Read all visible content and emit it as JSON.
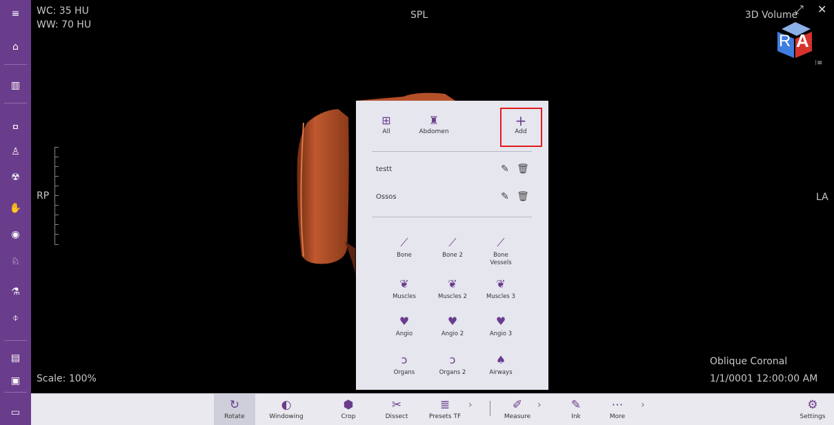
{
  "sidebar": {
    "menu": "≡",
    "items": [
      {
        "name": "hamburger-menu-icon",
        "glyph": "≡"
      },
      {
        "name": "home-icon",
        "glyph": "⌂"
      },
      {
        "name": "library-icon",
        "glyph": "▥"
      },
      {
        "name": "lungs-icon",
        "glyph": "ߛ"
      },
      {
        "name": "body-icon",
        "glyph": "♙"
      },
      {
        "name": "radiation-icon",
        "glyph": "☢"
      },
      {
        "name": "hand-bones-icon",
        "glyph": "✋"
      },
      {
        "name": "brain-icon",
        "glyph": "◉"
      },
      {
        "name": "animal-icon",
        "glyph": "♘"
      },
      {
        "name": "microscope-icon",
        "glyph": "⚗"
      },
      {
        "name": "attachment-icon",
        "glyph": "⌽"
      },
      {
        "name": "slides-icon",
        "glyph": "▤"
      },
      {
        "name": "snapshot-icon",
        "glyph": "▣"
      },
      {
        "name": "save-icon",
        "glyph": "▭"
      }
    ]
  },
  "viewport": {
    "wc": "WC: 35 HU",
    "ww": "WW: 70 HU",
    "orientation_top": "SPL",
    "mode": "3D Volume",
    "left_label": "RP",
    "right_label": "LA",
    "scale": "Scale: 100%",
    "view_name": "Oblique Coronal",
    "datetime": "1/1/0001 12:00:00 AM",
    "cube_letters": [
      "R",
      "A"
    ],
    "list_icon": "⁝≡"
  },
  "panel": {
    "top_buttons": [
      {
        "label": "All",
        "icon": "⊞"
      },
      {
        "label": "Abdomen",
        "icon": "♜"
      },
      {
        "label": "Add",
        "icon": "+"
      }
    ],
    "saved": [
      {
        "name": "testt",
        "edit": "✎",
        "delete": "🗑"
      },
      {
        "name": "Ossos",
        "edit": "✎",
        "delete": "🗑"
      }
    ],
    "presets": [
      {
        "label": "Bone",
        "icon": "⟋"
      },
      {
        "label": "Bone 2",
        "icon": "⟋"
      },
      {
        "label": "Bone\nVessels",
        "icon": "⟋"
      },
      {
        "label": "Muscles",
        "icon": "❦"
      },
      {
        "label": "Muscles 2",
        "icon": "❦"
      },
      {
        "label": "Muscles 3",
        "icon": "❦"
      },
      {
        "label": "Angio",
        "icon": "♥"
      },
      {
        "label": "Angio 2",
        "icon": "♥"
      },
      {
        "label": "Angio 3",
        "icon": "♥"
      },
      {
        "label": "Organs",
        "icon": "ɔ"
      },
      {
        "label": "Organs 2",
        "icon": "ɔ"
      },
      {
        "label": "Airways",
        "icon": "♠"
      }
    ]
  },
  "toolbar": {
    "items": [
      {
        "label": "Rotate",
        "icon": "↻"
      },
      {
        "label": "Windowing",
        "icon": "◐"
      },
      {
        "label": "Crop",
        "icon": "⬢"
      },
      {
        "label": "Dissect",
        "icon": "✂"
      },
      {
        "label": "Presets TF",
        "icon": "≣"
      },
      {
        "label": "Measure",
        "icon": "✐"
      },
      {
        "label": "Ink",
        "icon": "✎"
      },
      {
        "label": "More",
        "icon": "⋯"
      },
      {
        "label": "Settings",
        "icon": "⚙"
      }
    ],
    "chevron": "›"
  },
  "window": {
    "expand": "⤢",
    "close": "✕"
  },
  "colors": {
    "accent": "#6a3d8c",
    "highlight": "#e21b1b",
    "tissue": "#b5512a"
  }
}
